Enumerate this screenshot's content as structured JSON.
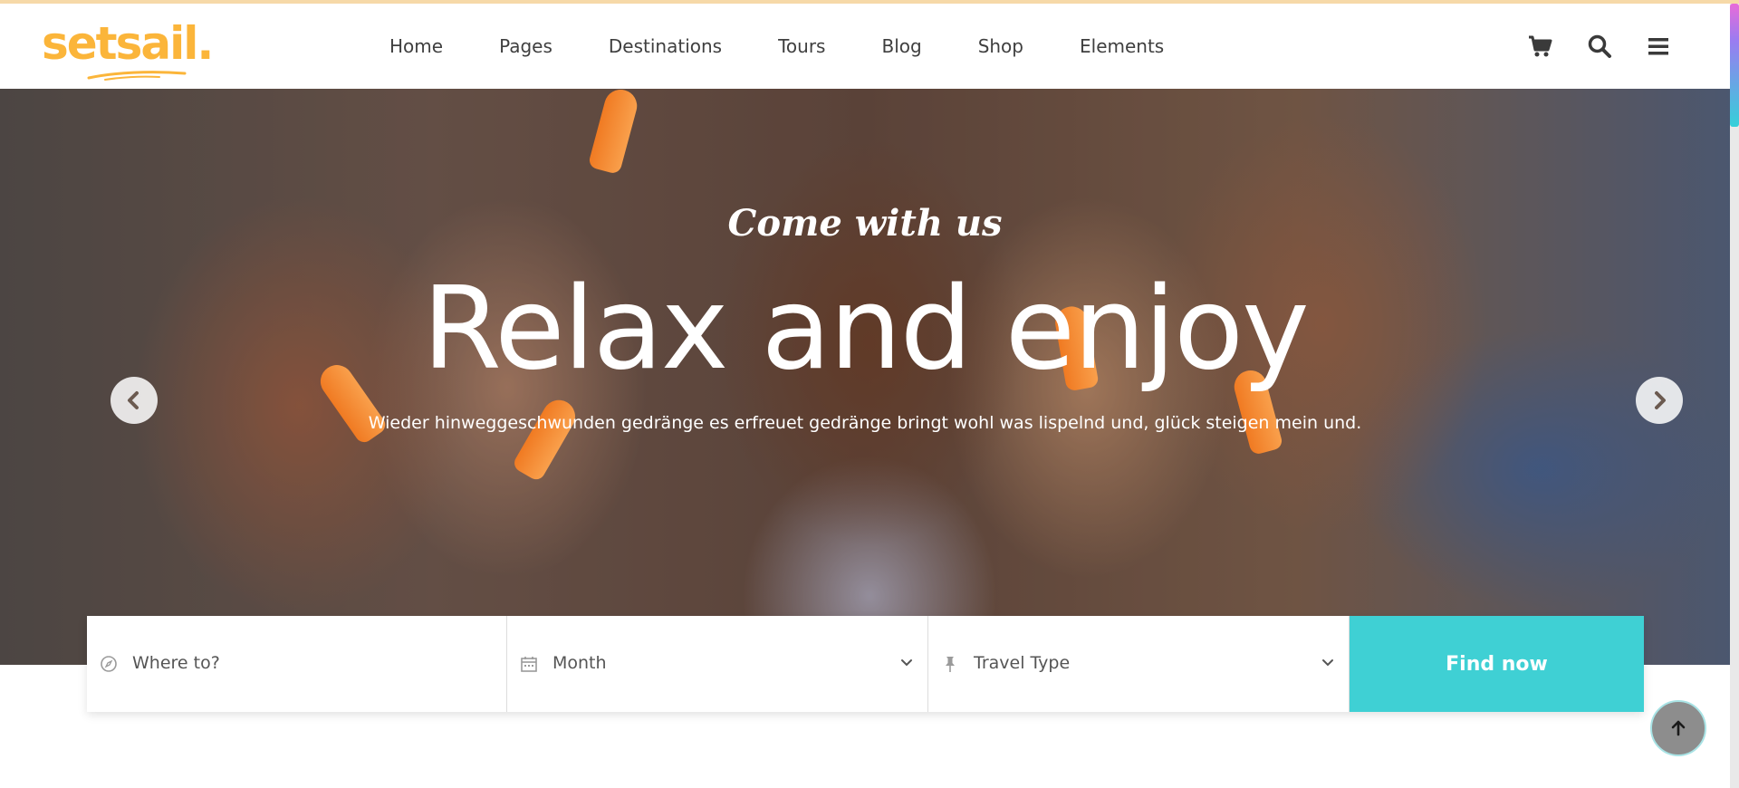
{
  "brand": {
    "logo_text": "setsail.",
    "logo_color": "#fbb53a"
  },
  "nav": {
    "items": [
      "Home",
      "Pages",
      "Destinations",
      "Tours",
      "Blog",
      "Shop",
      "Elements"
    ]
  },
  "header_icons": [
    "cart-icon",
    "search-icon",
    "menu-icon"
  ],
  "hero": {
    "subtitle": "Come with us",
    "title": "Relax and enjoy",
    "description": "Wieder hinweggeschwunden gedränge es erfreuet gedränge bringt wohl was lispelnd und, glück steigen mein und.",
    "prev_icon": "chevron-left-icon",
    "next_icon": "chevron-right-icon"
  },
  "search": {
    "destination_placeholder": "Where to?",
    "month_label": "Month",
    "travel_type_label": "Travel Type",
    "button_label": "Find now",
    "button_color": "#3fd0d4"
  },
  "back_to_top_icon": "arrow-up-icon"
}
